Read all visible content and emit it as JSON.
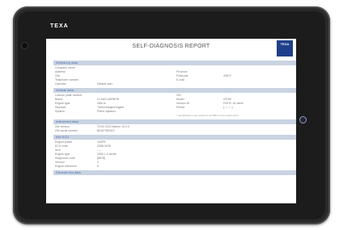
{
  "device": {
    "brand": "TEXA"
  },
  "report": {
    "title": "SELF-DIAGNOSIS REPORT",
    "logo_text": "TEXA",
    "sections": [
      {
        "title": "Workshop data",
        "rows": [
          {
            "l1": "Company name",
            "v1": "",
            "l2": "",
            "v2": ""
          },
          {
            "l1": "Address",
            "v1": "",
            "l2": "Province",
            "v2": ""
          },
          {
            "l1": "City",
            "v1": "",
            "l2": "Postcode",
            "v2": "20872"
          },
          {
            "l1": "Telephone number",
            "v1": "",
            "l2": "E-mail",
            "v2": ""
          },
          {
            "l1": "Operator",
            "v1": "Default user",
            "l2": "",
            "v2": ""
          }
        ]
      },
      {
        "title": "Vehicle data",
        "rows": [
          {
            "l1": "Licence plate number",
            "v1": "",
            "l2": "VIN",
            "v2": ""
          },
          {
            "l1": "Brand",
            "v1": "CLAAS HARBOR",
            "l2": "Model",
            "v2": "ATOM"
          },
          {
            "l1": "Engine type",
            "v1": "DBA tc",
            "l2": "Version ID",
            "v2": "DOHC 16 Valve"
          },
          {
            "l1": "Displace",
            "v1": "Turbocharged engine",
            "l2": "Period",
            "v2": "(- / - / -)"
          },
          {
            "l1": "System",
            "v1": "Petrol injection",
            "l2": "",
            "v2": ""
          }
        ],
        "note": "* Identification code obtained via OBD on the engine ECU"
      },
      {
        "title": "Instrument data",
        "rows": [
          {
            "l1": "SW version",
            "v1": "TXS4 2022 Marine 10.0.0",
            "l2": "",
            "v2": ""
          },
          {
            "l1": "HW serial number",
            "v1": "BIN07350023",
            "l2": "",
            "v2": ""
          }
        ]
      },
      {
        "title": "Info ECU",
        "rows": [
          {
            "l1": "Engine power",
            "v1": "184PS",
            "l2": "",
            "v2": ""
          },
          {
            "l1": "ECU code",
            "v1": "0068 4108",
            "l2": "",
            "v2": ""
          },
          {
            "l1": "Size",
            "v1": "----",
            "l2": "",
            "v2": ""
          },
          {
            "l1": "Engine type",
            "v1": "2000 L 4 stroke",
            "l2": "",
            "v2": ""
          },
          {
            "l1": "Diagnostic code",
            "v1": "[8878]",
            "l2": "",
            "v2": ""
          },
          {
            "l1": "Version",
            "v1": "2",
            "l2": "",
            "v2": ""
          },
          {
            "l1": "Engine reference",
            "v1": "8",
            "l2": "",
            "v2": ""
          }
        ]
      },
      {
        "title": "General ecu data",
        "rows": []
      }
    ]
  }
}
